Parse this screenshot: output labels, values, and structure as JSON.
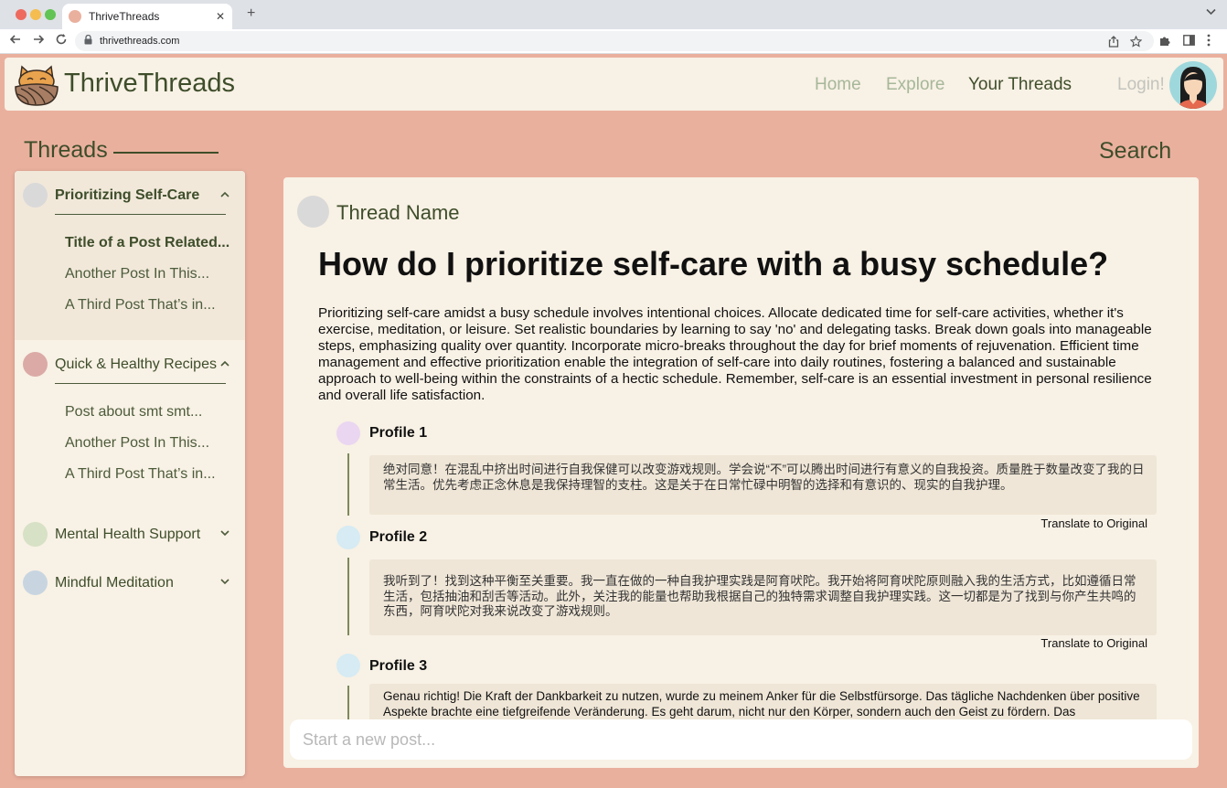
{
  "browser": {
    "tab_title": "ThriveThreads",
    "tab_close": "✕",
    "new_tab": "+",
    "url": "thrivethreads.com"
  },
  "header": {
    "brand": "ThriveThreads",
    "nav": [
      {
        "label": "Home",
        "color": "#a6b799"
      },
      {
        "label": "Explore",
        "color": "#a6b799"
      },
      {
        "label": "Your Threads",
        "color": "#3e4d2a"
      },
      {
        "label": "Login!",
        "color": "#c2c4be"
      }
    ]
  },
  "sidebar": {
    "heading": "Threads",
    "search_label": "Search",
    "groups": [
      {
        "label": "Prioritizing Self-Care",
        "circle_color": "#d9d9d9",
        "expanded": true,
        "active": true,
        "posts": [
          "Title of a Post Related...",
          "Another Post In This...",
          "A Third Post That’s in..."
        ]
      },
      {
        "label": "Quick & Healthy Recipes",
        "circle_color": "#dbaaa6",
        "expanded": true,
        "posts": [
          "Post about smt smt...",
          "Another Post In This...",
          "A Third Post That’s in..."
        ]
      },
      {
        "label": "Mental Health Support",
        "circle_color": "#d7e1c5",
        "expanded": false
      },
      {
        "label": "Mindful Meditation",
        "circle_color": "#c8d5e1",
        "expanded": false
      }
    ]
  },
  "main": {
    "thread_name": "Thread Name",
    "question": "How do I prioritize self-care with a busy schedule?",
    "body": "Prioritizing self-care amidst a busy schedule involves intentional choices. Allocate dedicated time for self-care activities, whether it's exercise, meditation, or leisure. Set realistic boundaries by learning to say 'no' and delegating tasks. Break down goals into manageable steps, emphasizing quality over quantity. Incorporate micro-breaks throughout the day for brief moments of rejuvenation. Efficient time management and effective prioritization enable the integration of self-care into daily routines, fostering a balanced and sustainable approach to well-being within the constraints of a hectic schedule. Remember, self-care is an essential investment in personal resilience and overall life satisfaction.",
    "replies": [
      {
        "name": "Profile 1",
        "avatar_color": "#ead6f1",
        "text": "绝对同意！在混乱中挤出时间进行自我保健可以改变游戏规则。学会说“不”可以腾出时间进行有意义的自我投资。质量胜于数量改变了我的日常生活。优先考虑正念休息是我保持理智的支柱。这是关于在日常忙碌中明智的选择和有意识的、现实的自我护理。",
        "translate_label": "Translate to Original"
      },
      {
        "name": "Profile 2",
        "avatar_color": "#d6ebf3",
        "text": "我听到了！找到这种平衡至关重要。我一直在做的一种自我护理实践是阿育吠陀。我开始将阿育吠陀原则融入我的生活方式，比如遵循日常生活，包括抽油和刮舌等活动。此外，关注我的能量也帮助我根据自己的独特需求调整自我护理实践。这一切都是为了找到与你产生共鸣的东西，阿育吠陀对我来说改变了游戏规则。",
        "translate_label": "Translate to Original"
      },
      {
        "name": "Profile 3",
        "avatar_color": "#d6ebf3",
        "text": "Genau richtig! Die Kraft der Dankbarkeit zu nutzen, wurde zu meinem Anker für die Selbstfürsorge. Das tägliche Nachdenken über positive Aspekte brachte eine tiefgreifende Veränderung. Es geht darum, nicht nur den Körper, sondern auch den Geist zu fördern. Das"
      }
    ],
    "new_post_placeholder": "Start a new post..."
  }
}
